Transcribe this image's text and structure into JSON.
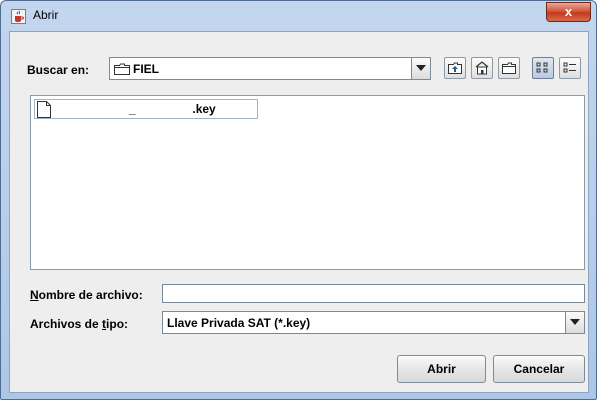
{
  "window": {
    "title": "Abrir",
    "close_glyph": "x"
  },
  "toolbar": {
    "look_in_label": "Buscar en:",
    "look_in_value": "FIEL",
    "buttons": [
      "up-one-level-icon",
      "home-icon",
      "new-folder-icon",
      "list-view-icon",
      "details-view-icon"
    ]
  },
  "file_list": {
    "items": [
      {
        "name": "                     _                 .key",
        "icon": "file-icon"
      }
    ]
  },
  "form": {
    "filename_label_first": "N",
    "filename_label_rest": "ombre de archivo:",
    "filename_value": "",
    "filetype_label_pre": "Archivos de ",
    "filetype_label_ul": "t",
    "filetype_label_post": "ipo:",
    "filetype_value": "Llave Privada SAT (*.key)"
  },
  "buttons": {
    "open_label": "Abrir",
    "cancel_label": "Cancelar"
  },
  "colors": {
    "title_bar": "#b9cfea",
    "close_button": "#c9432a",
    "dialog_bg": "#eeeeee"
  }
}
